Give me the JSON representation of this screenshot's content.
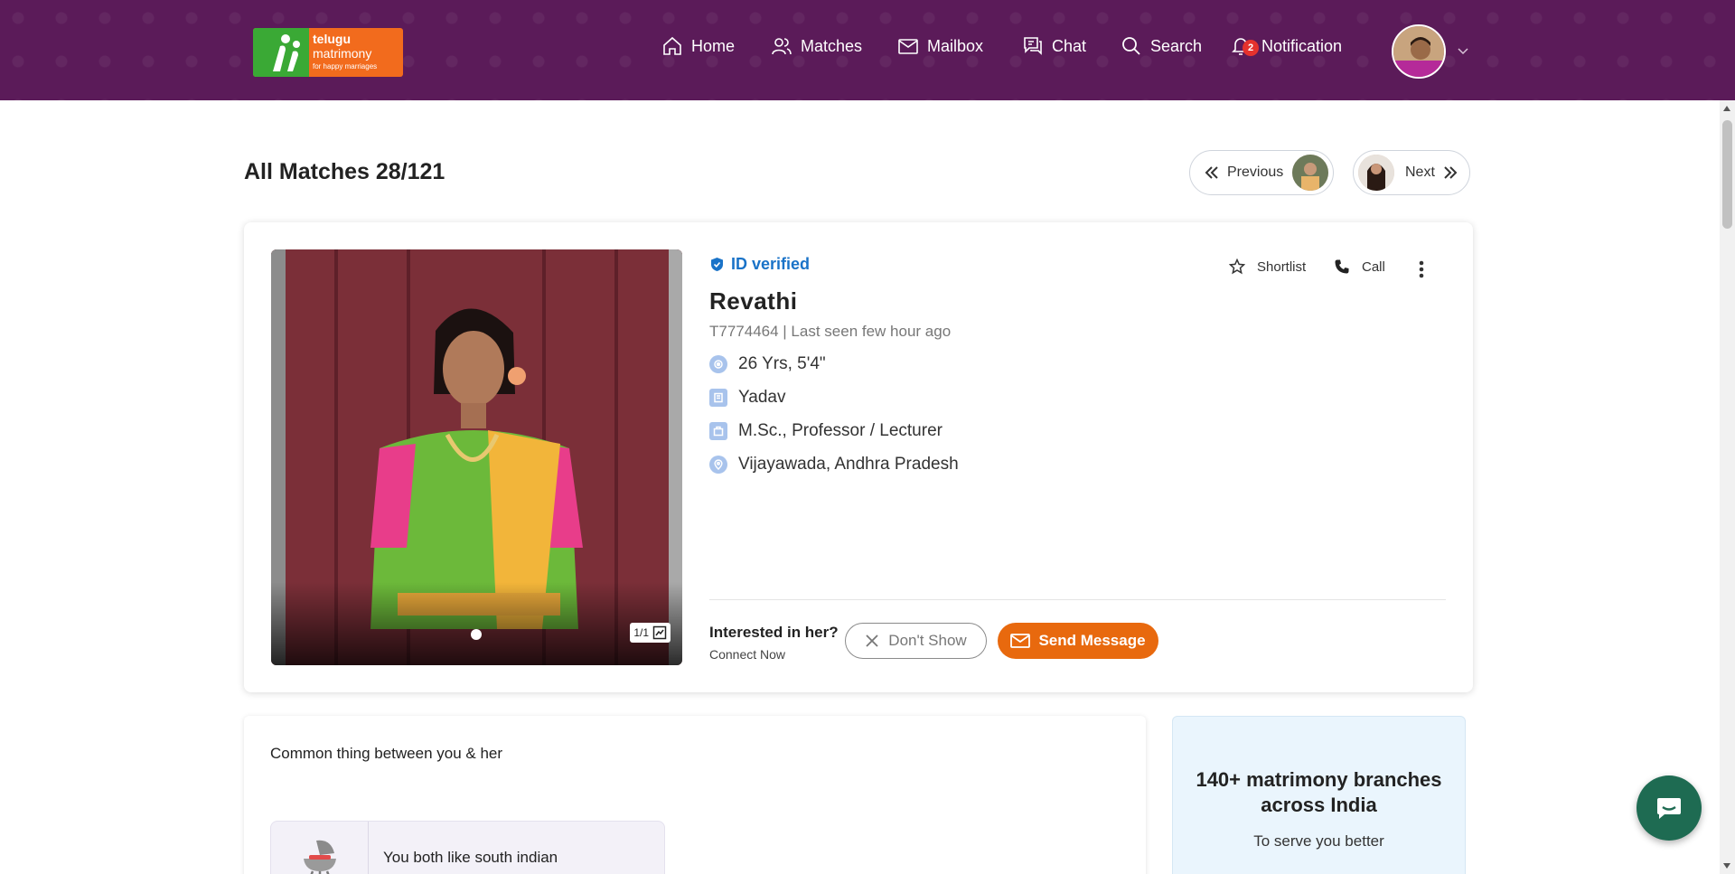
{
  "brand": {
    "line1": "telugu",
    "line2": "matrimony",
    "tagline": "for happy marriages"
  },
  "nav": {
    "home": "Home",
    "matches": "Matches",
    "mailbox": "Mailbox",
    "chat": "Chat",
    "search": "Search",
    "notification": "Notification",
    "notification_count": "2"
  },
  "page": {
    "title": "All Matches 28/121",
    "previous_label": "Previous",
    "next_label": "Next"
  },
  "profile": {
    "verified_label": "ID verified",
    "name": "Revathi",
    "id_line": "T7774464 | Last seen few hour ago",
    "age_height": "26 Yrs, 5'4\"",
    "caste": "Yadav",
    "education_job": "M.Sc., Professor / Lecturer",
    "location": "Vijayawada, Andhra Pradesh",
    "photo_count": "1/1",
    "shortlist_label": "Shortlist",
    "call_label": "Call",
    "interested_label": "Interested in her?",
    "connect_label": "Connect Now",
    "dont_show_label": "Don't Show",
    "send_message_label": "Send Message"
  },
  "common": {
    "title": "Common thing between you & her",
    "item_text": "You both like south indian"
  },
  "branches": {
    "heading": "140+ matrimony branches across India",
    "subheading": "To serve you better"
  },
  "colors": {
    "header_bg": "#5b1b59",
    "accent_orange": "#e8690e",
    "verified_blue": "#1a73c8",
    "chat_green": "#1e6b52"
  }
}
